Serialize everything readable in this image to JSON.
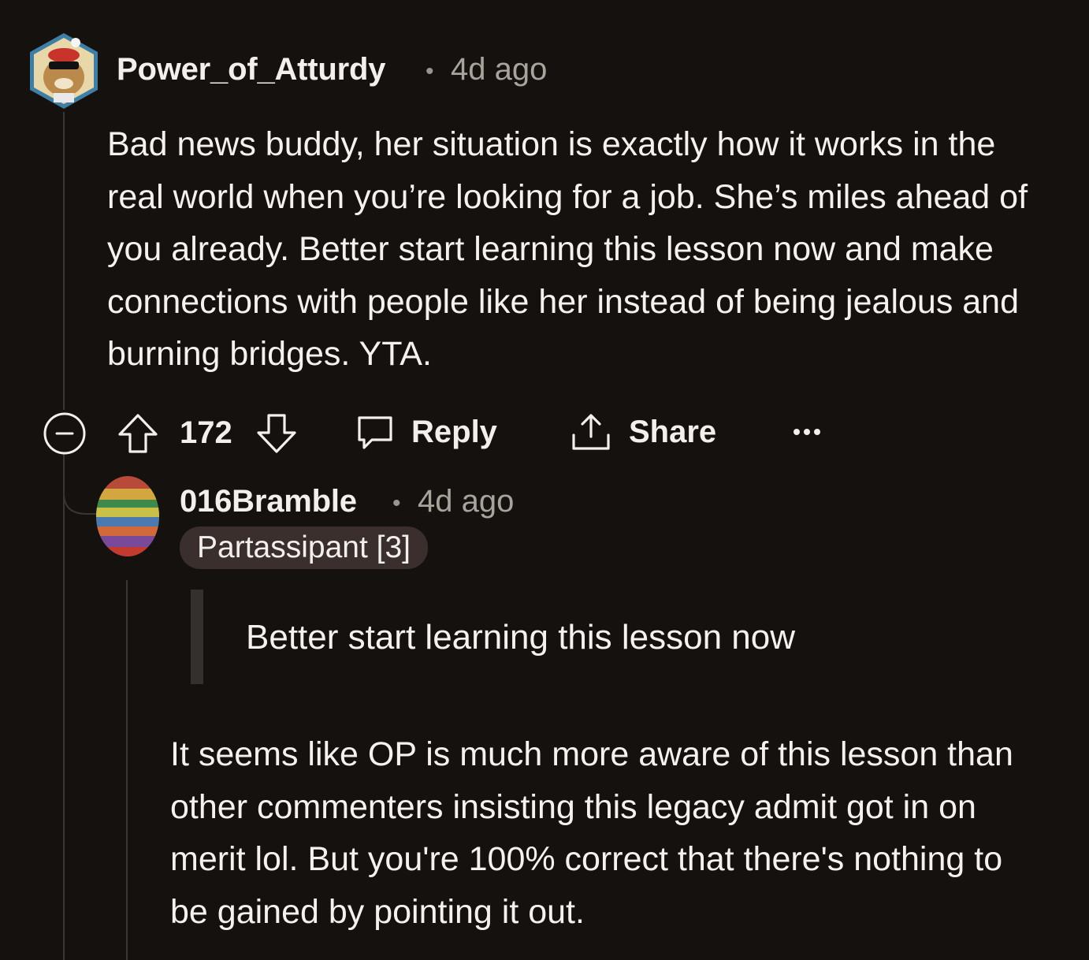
{
  "comment": {
    "author": "Power_of_Atturdy",
    "separator": "•",
    "time": "4d ago",
    "body": "Bad news buddy, her situation is exactly how it works in the real world when you’re looking for a job. She’s miles ahead of you already. Better start learning this lesson now and make connections with people like her instead of being jealous and burning bridges. YTA.",
    "votes": "172",
    "reply_label": "Reply",
    "share_label": "Share",
    "more_label": "•••"
  },
  "reply": {
    "author": "016Bramble",
    "separator": "•",
    "time": "4d ago",
    "flair": "Partassipant [3]",
    "quote": "Better start learning this lesson now",
    "body": "It seems like OP is much more aware of this lesson than other commenters insisting this legacy admit got in on merit lol. But you're 100% correct that there's nothing to be gained by pointing it out."
  },
  "colors": {
    "background": "#14110f",
    "text": "#f2efec",
    "muted": "#aaa39c",
    "flair_bg": "#3a2f2c",
    "thread_line": "#3b3633"
  }
}
